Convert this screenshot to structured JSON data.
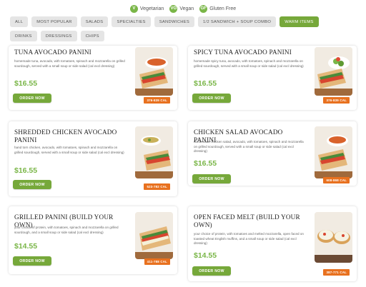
{
  "legend": [
    {
      "label": "Vegetarian",
      "icon": "leaf-icon",
      "glyph": "V"
    },
    {
      "label": "Vegan",
      "icon": "leaf-icon",
      "glyph": "VG"
    },
    {
      "label": "Gluten Free",
      "icon": "wheat-icon",
      "glyph": "GF"
    }
  ],
  "filters": [
    {
      "label": "ALL",
      "active": false
    },
    {
      "label": "MOST POPULAR",
      "active": false
    },
    {
      "label": "SALADS",
      "active": false
    },
    {
      "label": "SPECIALTIES",
      "active": false
    },
    {
      "label": "SANDWICHES",
      "active": false
    },
    {
      "label": "1/2 SANDWICH + SOUP COMBO",
      "active": false
    },
    {
      "label": "WARM ITEMS",
      "active": true
    },
    {
      "label": "DRINKS",
      "active": false
    },
    {
      "label": "DRESSINGS",
      "active": false
    },
    {
      "label": "CHIPS",
      "active": false
    }
  ],
  "order_label": "ORDER NOW",
  "accent_color": "#76a83a",
  "calorie_color": "#e8711f",
  "items": [
    {
      "name": "TUNA AVOCADO PANINI",
      "description": "homemade tuna, avocado, with tomatoes, spinach and mozzarella on grilled sourdough, served with a small soup or side salad (cal excl dressing)",
      "price": "$16.55",
      "calories": "376-839 CAL",
      "image": "panini-with-soup"
    },
    {
      "name": "SPICY TUNA AVOCADO PANINI",
      "description": "homemade spicy tuna, avocado, with tomatoes, spinach and mozzarella on grilled sourdough, served with a small soup or side salad (cal excl dressing)",
      "price": "$16.55",
      "calories": "376-839 CAL",
      "image": "panini-with-salad"
    },
    {
      "name": "SHREDDED CHICKEN AVOCADO PANINI",
      "description": "hand torn chicken, avocado, with tomatoes, spinach and mozzarella on grilled sourdough, served with a small soup or side salad (cal excl dressing)",
      "price": "$16.55",
      "calories": "523-782 CAL",
      "image": "panini-with-soup"
    },
    {
      "name": "CHICKEN SALAD AVOCADO PANINI",
      "description": "homemade chicken salad, avocado, with tomatoes, spinach and mozzarella on grilled sourdough, served with a small soup or side salad (cal excl dressing)",
      "price": "$16.55",
      "calories": "608-868 CAL",
      "image": "panini-with-soup"
    },
    {
      "name": "GRILLED PANINI (BUILD YOUR OWN)",
      "description": "your choice of protein, with tomatoes, spinach and mozzarella on grilled sourdough, and a small soup or side salad (cal excl dressing)",
      "price": "$14.55",
      "calories": "411-788 CAL",
      "image": "panini-plain"
    },
    {
      "name": "OPEN FACED MELT (BUILD YOUR OWN)",
      "description": "your choice of protein, with tomatoes and melted mozzarella, open faced on toasted wheat English muffins, and a small soup or side salad (cal excl dressing)",
      "price": "$14.55",
      "calories": "387-771 CAL",
      "image": "open-faced-melt"
    }
  ]
}
